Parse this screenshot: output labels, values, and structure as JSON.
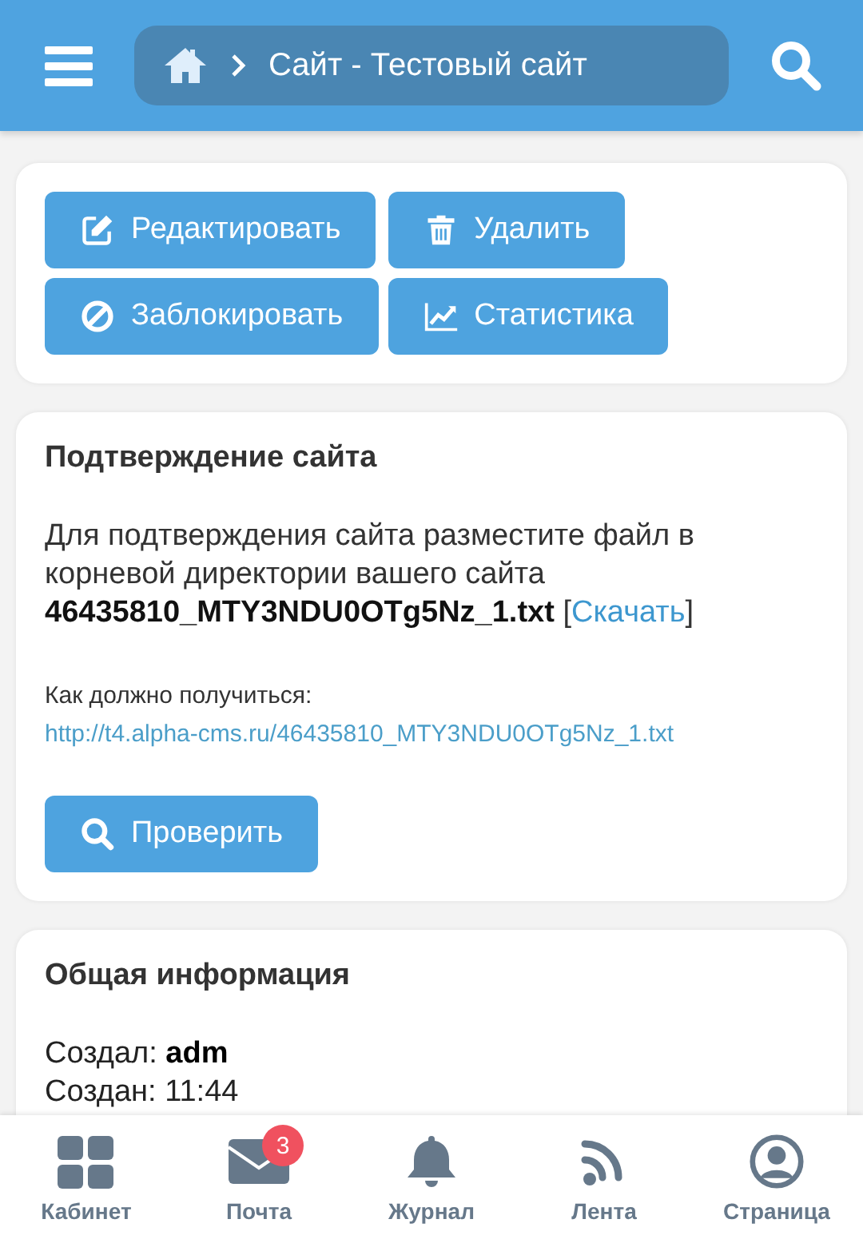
{
  "header": {
    "breadcrumb": "Сайт - Тестовый сайт"
  },
  "actions": [
    {
      "label": "Редактировать"
    },
    {
      "label": "Удалить"
    },
    {
      "label": "Заблокировать"
    },
    {
      "label": "Статистика"
    }
  ],
  "verification": {
    "title": "Подтверждение сайта",
    "message": "Для подтверждения сайта разместите файл в корневой директории вашего сайта **46435810_MTY3NDU0OTg5Nz_1.txt** [",
    "download_link": "Скачать",
    "message_end": "]",
    "expected_label": "Как должно получиться:",
    "expected_url": "http://t4.alpha-cms.ru/46435810_MTY3NDU0OTg5Nz_1.txt",
    "check_button": "Проверить"
  },
  "general": {
    "title": "Общая информация",
    "fields": [
      "Создал: **adm**",
      "Создан: 11:44"
    ]
  },
  "bottom_nav": [
    {
      "label": "Кабинет"
    },
    {
      "label": "Почта",
      "badge": "3"
    },
    {
      "label": "Журнал"
    },
    {
      "label": "Лента"
    },
    {
      "label": "Страница"
    }
  ]
}
